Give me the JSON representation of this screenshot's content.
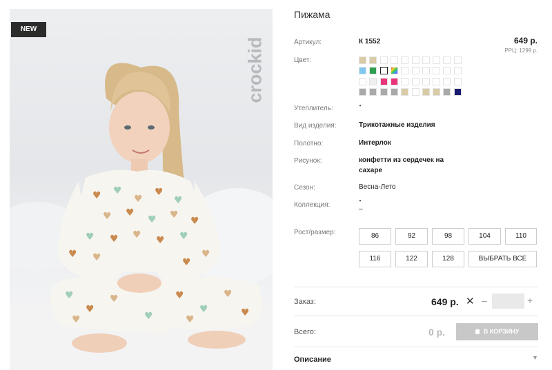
{
  "photo": {
    "badge": "NEW",
    "brand": "crockid",
    "alt": "Girl in pajama with hearts"
  },
  "product": {
    "title": "Пижама",
    "price": "649 р.",
    "rrp": "РРЦ: 1299 р."
  },
  "attributes": {
    "article_label": "Артикул:",
    "article_value": "К 1552",
    "color_label": "Цвет:",
    "insulation_label": "Утеплитель:",
    "insulation_value": "\"",
    "kind_label": "Вид изделия:",
    "kind_value": "Трикотажные изделия",
    "fabric_label": "Полотно:",
    "fabric_value": "Интерлок",
    "pattern_label": "Рисунок:",
    "pattern_value": "конфетти из сердечек на сахаре",
    "season_label": "Сезон:",
    "season_value": "Весна-Лето",
    "collection_label": "Коллекция:",
    "collection_value_1": "\"",
    "collection_value_2": "–",
    "size_label": "Рост/размер:"
  },
  "colors": [
    [
      "#d9cba5",
      "#d9cba5",
      "#ffffff",
      "#ffffff",
      "#ffffff",
      "#ffffff",
      "#ffffff",
      "#ffffff",
      "#ffffff",
      "#ffffff"
    ],
    [
      "#7ec8f0",
      "#2e9e4f",
      "#ffffff",
      "rainbow",
      "#ffffff",
      "#ffffff",
      "#ffffff",
      "#ffffff",
      "#ffffff",
      "#ffffff"
    ],
    [
      "#ffffff",
      "#f0f0f0",
      "#e8347a",
      "#e8347a",
      "#ffffff",
      "#ffffff",
      "#ffffff",
      "#ffffff",
      "#ffffff",
      "#ffffff"
    ],
    [
      "#a9a9a9",
      "#a9a9a9",
      "#a9a9a9",
      "#a9a9a9",
      "#d9cba5",
      "#ffffff",
      "#d9cba5",
      "#d9cba5",
      "#a9a9a9",
      "#1a1a6e"
    ]
  ],
  "selected_color": [
    1,
    1
  ],
  "sizes": [
    "86",
    "92",
    "98",
    "104",
    "110",
    "116",
    "122",
    "128"
  ],
  "select_all": "ВЫБРАТЬ ВСЕ",
  "order": {
    "label": "Заказ:",
    "price": "649 р.",
    "times_icon": "✕",
    "minus": "–",
    "plus": "+",
    "qty": ""
  },
  "total": {
    "label": "Всего:",
    "value": "0 р.",
    "cart_button": "В КОРЗИНУ"
  },
  "description": {
    "label": "Описание",
    "chevron": "▼"
  }
}
